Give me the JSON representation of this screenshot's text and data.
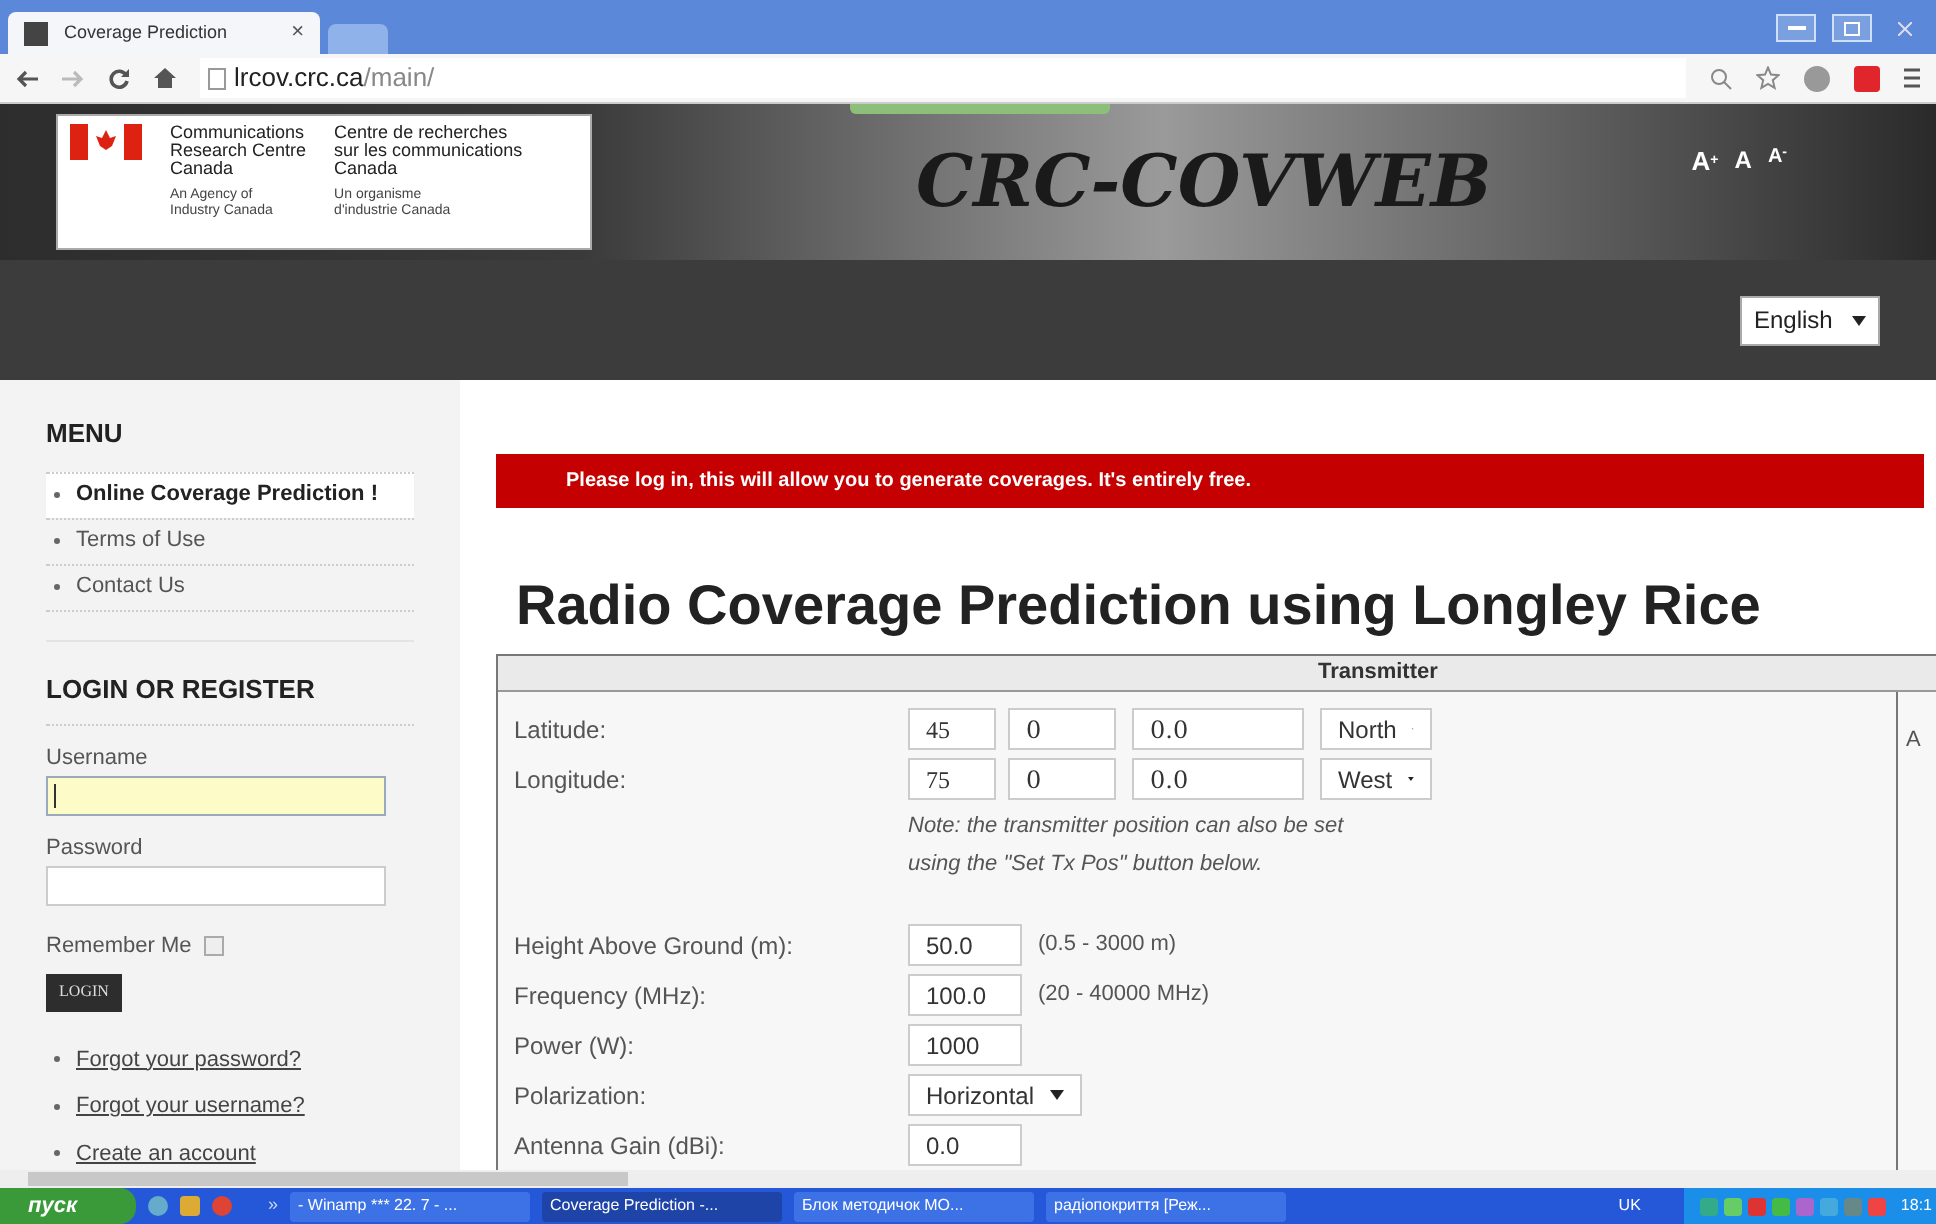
{
  "browser": {
    "tabs": [
      {
        "title": "Coverage Prediction",
        "close": "×",
        "selected": true
      },
      {
        "selected": false
      }
    ],
    "url_host": "lrcov.crc.ca",
    "url_path": "/main/"
  },
  "header": {
    "logo": {
      "en": [
        "Communications",
        "Research Centre",
        "Canada"
      ],
      "fr": [
        "Centre de recherches",
        "sur les communications",
        "Canada"
      ],
      "en_sub": [
        "An Agency of",
        "Industry Canada"
      ],
      "fr_sub": [
        "Un organisme",
        "d'industrie Canada"
      ]
    },
    "site_title": "CRC-COVWEB",
    "font_sizes": [
      {
        "label": "A",
        "mark": "+"
      },
      {
        "label": "A"
      },
      {
        "label": "A",
        "mark": "-"
      }
    ]
  },
  "language": {
    "value": "English"
  },
  "sidebar": {
    "menu_title": "MENU",
    "menu": [
      {
        "label": "Online Coverage Prediction !",
        "selected": true
      },
      {
        "label": "Terms of Use",
        "selected": false
      },
      {
        "label": "Contact Us",
        "selected": false
      }
    ],
    "login_title": "LOGIN OR REGISTER",
    "username_label": "Username",
    "password_label": "Password",
    "remember_label": "Remember Me",
    "remember_checked": false,
    "login_button": "LOGIN",
    "links": [
      "Forgot your password?",
      "Forgot your username?",
      "Create an account"
    ]
  },
  "banner": "Please log in, this will allow you to generate coverages. It's entirely free.",
  "heading": "Radio Coverage Prediction using Longley Rice",
  "table": {
    "header": "Transmitter",
    "side_letter": "A",
    "rows": [
      {
        "kind": "dms",
        "label": "Latitude:",
        "deg": "45",
        "min": "0",
        "sec": "0.0",
        "hemisphere": "North"
      },
      {
        "kind": "dms",
        "label": "Longitude:",
        "deg": "75",
        "min": "0",
        "sec": "0.0",
        "hemisphere": "West"
      },
      {
        "kind": "note",
        "lines": [
          "Note: the transmitter position can also be set",
          "using the \"Set Tx Pos\" button below."
        ]
      },
      {
        "kind": "input",
        "label": "Height Above Ground (m):",
        "value": "50.0",
        "hint": "(0.5 - 3000 m)"
      },
      {
        "kind": "input",
        "label": "Frequency (MHz):",
        "value": "100.0",
        "hint": "(20 - 40000 MHz)"
      },
      {
        "kind": "input",
        "label": "Power (W):",
        "value": "1000"
      },
      {
        "kind": "select",
        "label": "Polarization:",
        "value": "Horizontal"
      },
      {
        "kind": "input",
        "label": "Antenna Gain (dBi):",
        "value": "0.0"
      }
    ]
  },
  "taskbar": {
    "start": "пуск",
    "more": "»",
    "tasks": [
      {
        "label": "- Winamp *** 22. 7 - ...",
        "selected": false
      },
      {
        "label": "Coverage Prediction -...",
        "selected": true
      },
      {
        "label": "Блок методичок МО...",
        "selected": false
      },
      {
        "label": "радіопокриття [Реж...",
        "selected": false
      }
    ],
    "language": "UK",
    "clock": "18:1"
  }
}
